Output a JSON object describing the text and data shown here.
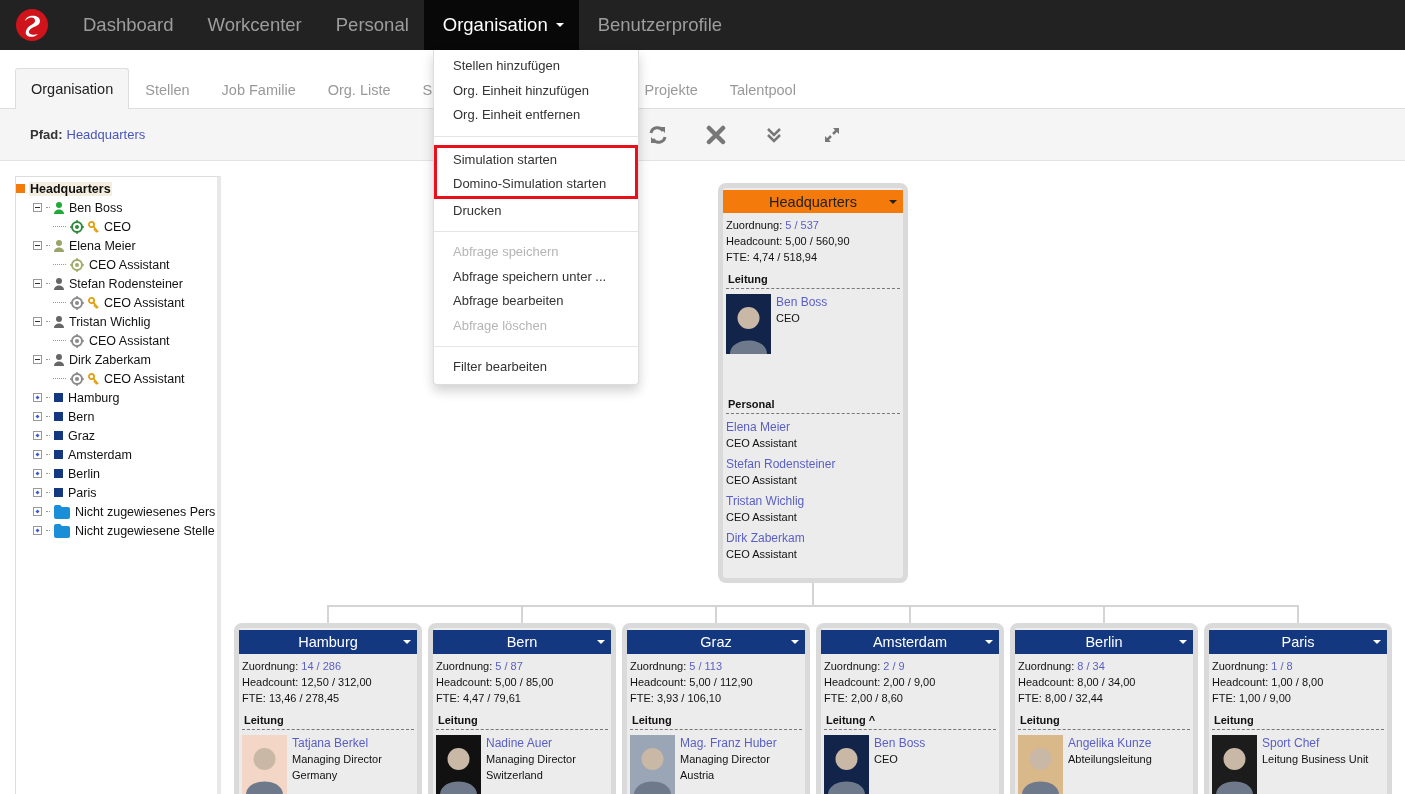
{
  "navbar": {
    "items": [
      {
        "label": "Dashboard",
        "selected": false,
        "dropdown": false
      },
      {
        "label": "Workcenter",
        "selected": false,
        "dropdown": false
      },
      {
        "label": "Personal",
        "selected": false,
        "dropdown": false
      },
      {
        "label": "Organisation",
        "selected": true,
        "dropdown": true
      },
      {
        "label": "Benutzerprofile",
        "selected": false,
        "dropdown": false
      }
    ]
  },
  "tabs": [
    {
      "label": "Organisation",
      "selected": true
    },
    {
      "label": "Stellen",
      "selected": false
    },
    {
      "label": "Job Familie",
      "selected": false
    },
    {
      "label": "Org. Liste",
      "selected": false
    },
    {
      "label": "S",
      "selected": false,
      "cut": true
    },
    {
      "label": "Projekte",
      "selected": false
    },
    {
      "label": "Talentpool",
      "selected": false
    }
  ],
  "path": {
    "label": "Pfad:",
    "value": "Headquarters"
  },
  "toolbar": [
    {
      "kind": "refresh"
    },
    {
      "kind": "close"
    },
    {
      "kind": "collapse"
    },
    {
      "kind": "expand"
    }
  ],
  "tree": [
    {
      "label": "Headquarters",
      "kind": "unit",
      "color": "#f57a0c",
      "selected": true,
      "children": [
        {
          "label": "Ben Boss",
          "kind": "person",
          "color": "#22a83a",
          "selected": false,
          "expanded": true,
          "children": [
            {
              "label": "CEO",
              "kind": "position",
              "color": "#2e8b3e",
              "key": true,
              "selected": false
            }
          ]
        },
        {
          "label": "Elena Meier",
          "kind": "person",
          "color": "#9aa46a",
          "selected": false,
          "expanded": true,
          "children": [
            {
              "label": "CEO Assistant",
              "kind": "position",
              "color": "#a3ab6b",
              "key": false,
              "selected": false
            }
          ]
        },
        {
          "label": "Stefan Rodensteiner",
          "kind": "person",
          "color": "#666666",
          "selected": false,
          "expanded": true,
          "children": [
            {
              "label": "CEO Assistant",
              "kind": "position",
              "color": "#8a8a8a",
              "key": true,
              "selected": false
            }
          ]
        },
        {
          "label": "Tristan Wichlig",
          "kind": "person",
          "color": "#666666",
          "selected": false,
          "expanded": true,
          "children": [
            {
              "label": "CEO Assistant",
              "kind": "position",
              "color": "#8a8a8a",
              "key": false,
              "selected": false
            }
          ]
        },
        {
          "label": "Dirk Zaberkam",
          "kind": "person",
          "color": "#666666",
          "selected": false,
          "expanded": true,
          "children": [
            {
              "label": "CEO Assistant",
              "kind": "position",
              "color": "#8a8a8a",
              "key": true,
              "selected": false
            }
          ]
        },
        {
          "label": "Hamburg",
          "kind": "unit",
          "color": "#14387f",
          "selected": false,
          "expanded": false
        },
        {
          "label": "Bern",
          "kind": "unit",
          "color": "#14387f",
          "selected": false,
          "expanded": false
        },
        {
          "label": "Graz",
          "kind": "unit",
          "color": "#14387f",
          "selected": false,
          "expanded": false
        },
        {
          "label": "Amsterdam",
          "kind": "unit",
          "color": "#14387f",
          "selected": false,
          "expanded": false
        },
        {
          "label": "Berlin",
          "kind": "unit",
          "color": "#14387f",
          "selected": false,
          "expanded": false
        },
        {
          "label": "Paris",
          "kind": "unit",
          "color": "#14387f",
          "selected": false,
          "expanded": false
        },
        {
          "label": "Nicht zugewiesenes Pers",
          "kind": "folder",
          "selected": false,
          "expanded": false
        },
        {
          "label": "Nicht zugewiesene Stelle",
          "kind": "folder",
          "selected": false,
          "expanded": false
        }
      ]
    }
  ],
  "chart": {
    "root": {
      "title": "Headquarters",
      "kind": "root",
      "color": "#f57a0c",
      "zuordnung_label": "Zuordnung:",
      "zuordnung": "5 / 537",
      "headcount": "Headcount: 5,00 / 560,90",
      "fte": "FTE: 4,74 / 518,94",
      "sections": [
        {
          "title": "Leitung",
          "people": [
            {
              "name": "Ben Boss",
              "lines": [
                "CEO"
              ],
              "avatar": true
            }
          ]
        },
        {
          "title": "Personal",
          "people": [
            {
              "name": "Elena Meier",
              "lines": [
                "CEO Assistant"
              ],
              "avatar": false
            },
            {
              "name": "Stefan Rodensteiner",
              "lines": [
                "CEO Assistant"
              ],
              "avatar": false
            },
            {
              "name": "Tristan Wichlig",
              "lines": [
                "CEO Assistant"
              ],
              "avatar": false
            },
            {
              "name": "Dirk Zaberkam",
              "lines": [
                "CEO Assistant"
              ],
              "avatar": false
            }
          ]
        }
      ]
    },
    "children": [
      {
        "title": "Hamburg",
        "kind": "unit",
        "color": "#14387f",
        "zuordnung_label": "Zuordnung:",
        "zuordnung": "14 / 286",
        "headcount": "Headcount: 12,50 / 312,00",
        "fte": "FTE: 13,46 / 278,45",
        "sections": [
          {
            "title": "Leitung",
            "people": [
              {
                "name": "Tatjana Berkel",
                "lines": [
                  "Managing Director",
                  "Germany"
                ],
                "avatar": true
              }
            ]
          }
        ]
      },
      {
        "title": "Bern",
        "kind": "unit",
        "color": "#14387f",
        "zuordnung_label": "Zuordnung:",
        "zuordnung": "5 / 87",
        "headcount": "Headcount: 5,00 / 85,00",
        "fte": "FTE: 4,47 / 79,61",
        "sections": [
          {
            "title": "Leitung",
            "people": [
              {
                "name": "Nadine Auer",
                "lines": [
                  "Managing Director",
                  "Switzerland"
                ],
                "avatar": true
              }
            ]
          }
        ]
      },
      {
        "title": "Graz",
        "kind": "unit",
        "color": "#14387f",
        "zuordnung_label": "Zuordnung:",
        "zuordnung": "5 / 113",
        "headcount": "Headcount: 5,00 / 112,90",
        "fte": "FTE: 3,93 / 106,10",
        "sections": [
          {
            "title": "Leitung",
            "people": [
              {
                "name": "Mag. Franz Huber",
                "lines": [
                  "Managing Director",
                  "Austria"
                ],
                "avatar": true
              }
            ]
          }
        ]
      },
      {
        "title": "Amsterdam",
        "kind": "unit",
        "color": "#14387f",
        "zuordnung_label": "Zuordnung:",
        "zuordnung": "2 / 9",
        "headcount": "Headcount: 2,00 / 9,00",
        "fte": "FTE: 2,00 / 8,60",
        "sections": [
          {
            "title": "Leitung ^",
            "people": [
              {
                "name": "Ben Boss",
                "lines": [
                  "CEO"
                ],
                "avatar": true
              }
            ]
          }
        ]
      },
      {
        "title": "Berlin",
        "kind": "unit",
        "color": "#14387f",
        "zuordnung_label": "Zuordnung:",
        "zuordnung": "8 / 34",
        "headcount": "Headcount: 8,00 / 34,00",
        "fte": "FTE: 8,00 / 32,44",
        "sections": [
          {
            "title": "Leitung",
            "people": [
              {
                "name": "Angelika Kunze",
                "lines": [
                  "Abteilungsleitung"
                ],
                "avatar": true
              }
            ]
          }
        ]
      },
      {
        "title": "Paris",
        "kind": "unit",
        "color": "#14387f",
        "zuordnung_label": "Zuordnung:",
        "zuordnung": "1 / 8",
        "headcount": "Headcount: 1,00 / 8,00",
        "fte": "FTE: 1,00 / 9,00",
        "sections": [
          {
            "title": "Leitung",
            "people": [
              {
                "name": "Sport Chef",
                "lines": [
                  "Leitung Business Unit"
                ],
                "avatar": true
              }
            ]
          }
        ]
      }
    ]
  },
  "menu": {
    "groups": [
      [
        {
          "label": "Stellen hinzufügen",
          "disabled": false,
          "highlighted": false
        },
        {
          "label": "Org. Einheit hinzufügen",
          "disabled": false,
          "highlighted": false
        },
        {
          "label": "Org. Einheit entfernen",
          "disabled": false,
          "highlighted": false
        }
      ],
      [
        {
          "label": "Simulation starten",
          "disabled": false,
          "highlighted": true
        },
        {
          "label": "Domino-Simulation starten",
          "disabled": false,
          "highlighted": true
        },
        {
          "label": "Drucken",
          "disabled": false,
          "highlighted": false
        }
      ],
      [
        {
          "label": "Abfrage speichern",
          "disabled": true,
          "highlighted": false
        },
        {
          "label": "Abfrage speichern unter ...",
          "disabled": false,
          "highlighted": false
        },
        {
          "label": "Abfrage bearbeiten",
          "disabled": false,
          "highlighted": false
        },
        {
          "label": "Abfrage löschen",
          "disabled": true,
          "highlighted": false
        }
      ],
      [
        {
          "label": "Filter bearbeiten",
          "disabled": false,
          "highlighted": false
        }
      ]
    ]
  }
}
